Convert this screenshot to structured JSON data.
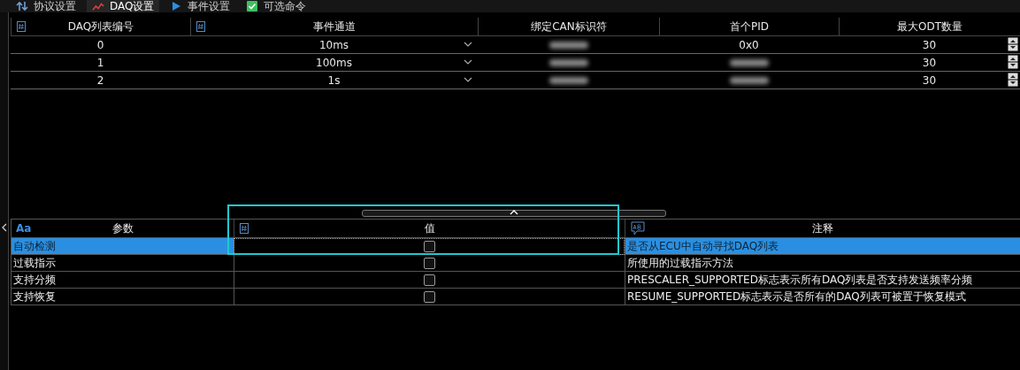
{
  "tabs": [
    {
      "label": "协议设置",
      "kind": "updown",
      "selected": false
    },
    {
      "label": "DAQ设置",
      "kind": "chart",
      "selected": true
    },
    {
      "label": "事件设置",
      "kind": "play",
      "selected": false
    },
    {
      "label": "可选命令",
      "kind": "check",
      "selected": false
    }
  ],
  "daq_table": {
    "columns": [
      {
        "label": "DAQ列表编号",
        "kind": "number"
      },
      {
        "label": "事件通道",
        "kind": "number"
      },
      {
        "label": "绑定CAN标识符",
        "kind": "plain"
      },
      {
        "label": "首个PID",
        "kind": "plain"
      },
      {
        "label": "最大ODT数量",
        "kind": "plain"
      }
    ],
    "rows": [
      {
        "list_number": "0",
        "event_channel": "10ms",
        "can_id_blurred": true,
        "first_pid": "0x0",
        "first_pid_blurred": false,
        "max_odt": "30"
      },
      {
        "list_number": "1",
        "event_channel": "100ms",
        "can_id_blurred": true,
        "first_pid_blurred": true,
        "max_odt": "30"
      },
      {
        "list_number": "2",
        "event_channel": "1s",
        "can_id_blurred": true,
        "first_pid_blurred": true,
        "max_odt": "30"
      }
    ]
  },
  "param_table": {
    "columns": [
      {
        "label": "参数",
        "kind": "text",
        "type_badge": "Aa"
      },
      {
        "label": "值",
        "kind": "number"
      },
      {
        "label": "注释",
        "kind": "comment"
      }
    ],
    "rows": [
      {
        "parameter": "自动检测",
        "checked": false,
        "selected": true,
        "comment": "是否从ECU中自动寻找DAQ列表"
      },
      {
        "parameter": "过载指示",
        "checked": false,
        "selected": false,
        "comment": "所使用的过载指示方法"
      },
      {
        "parameter": "支持分频",
        "checked": false,
        "selected": false,
        "comment": "PRESCALER_SUPPORTED标志表示所有DAQ列表是否支持发送频率分频"
      },
      {
        "parameter": "支持恢复",
        "checked": false,
        "selected": false,
        "comment": "RESUME_SUPPORTED标志表示是否所有的DAQ列表可被置于恢复模式"
      }
    ]
  }
}
